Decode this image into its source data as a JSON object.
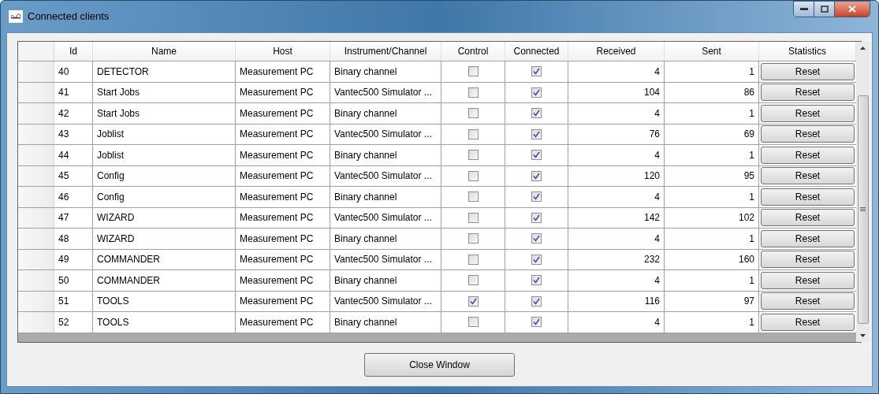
{
  "window": {
    "title": "Connected clients"
  },
  "table": {
    "columns": [
      "Id",
      "Name",
      "Host",
      "Instrument/Channel",
      "Control",
      "Connected",
      "Received",
      "Sent",
      "Statistics"
    ],
    "rows": [
      {
        "id": "40",
        "name": "DETECTOR",
        "host": "Measurement PC",
        "instrument": "Binary channel",
        "control": false,
        "connected": true,
        "received": "4",
        "sent": "1",
        "action": "Reset"
      },
      {
        "id": "41",
        "name": "Start Jobs",
        "host": "Measurement PC",
        "instrument": "Vantec500 Simulator ...",
        "control": false,
        "connected": true,
        "received": "104",
        "sent": "86",
        "action": "Reset"
      },
      {
        "id": "42",
        "name": "Start Jobs",
        "host": "Measurement PC",
        "instrument": "Binary channel",
        "control": false,
        "connected": true,
        "received": "4",
        "sent": "1",
        "action": "Reset"
      },
      {
        "id": "43",
        "name": "Joblist",
        "host": "Measurement PC",
        "instrument": "Vantec500 Simulator ...",
        "control": false,
        "connected": true,
        "received": "76",
        "sent": "69",
        "action": "Reset"
      },
      {
        "id": "44",
        "name": "Joblist",
        "host": "Measurement PC",
        "instrument": "Binary channel",
        "control": false,
        "connected": true,
        "received": "4",
        "sent": "1",
        "action": "Reset"
      },
      {
        "id": "45",
        "name": "Config",
        "host": "Measurement PC",
        "instrument": "Vantec500 Simulator ...",
        "control": false,
        "connected": true,
        "received": "120",
        "sent": "95",
        "action": "Reset"
      },
      {
        "id": "46",
        "name": "Config",
        "host": "Measurement PC",
        "instrument": "Binary channel",
        "control": false,
        "connected": true,
        "received": "4",
        "sent": "1",
        "action": "Reset"
      },
      {
        "id": "47",
        "name": "WIZARD",
        "host": "Measurement PC",
        "instrument": "Vantec500 Simulator ...",
        "control": false,
        "connected": true,
        "received": "142",
        "sent": "102",
        "action": "Reset"
      },
      {
        "id": "48",
        "name": "WIZARD",
        "host": "Measurement PC",
        "instrument": "Binary channel",
        "control": false,
        "connected": true,
        "received": "4",
        "sent": "1",
        "action": "Reset"
      },
      {
        "id": "49",
        "name": "COMMANDER",
        "host": "Measurement PC",
        "instrument": "Vantec500 Simulator ...",
        "control": false,
        "connected": true,
        "received": "232",
        "sent": "160",
        "action": "Reset"
      },
      {
        "id": "50",
        "name": "COMMANDER",
        "host": "Measurement PC",
        "instrument": "Binary channel",
        "control": false,
        "connected": true,
        "received": "4",
        "sent": "1",
        "action": "Reset"
      },
      {
        "id": "51",
        "name": "TOOLS",
        "host": "Measurement PC",
        "instrument": "Vantec500 Simulator ...",
        "control": true,
        "connected": true,
        "received": "116",
        "sent": "97",
        "action": "Reset"
      },
      {
        "id": "52",
        "name": "TOOLS",
        "host": "Measurement PC",
        "instrument": "Binary channel",
        "control": false,
        "connected": true,
        "received": "4",
        "sent": "1",
        "action": "Reset"
      }
    ]
  },
  "close_button": "Close Window"
}
